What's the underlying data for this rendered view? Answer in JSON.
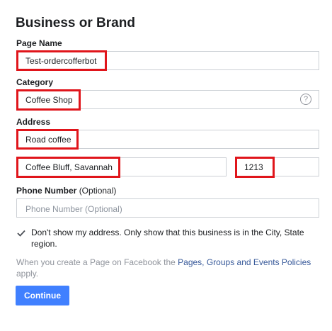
{
  "form": {
    "title": "Business or Brand",
    "page_name": {
      "label": "Page Name",
      "value": "Test-ordercofferbot"
    },
    "category": {
      "label": "Category",
      "value": "Coffee Shop",
      "help": "?"
    },
    "address": {
      "label": "Address",
      "street": "Road coffee",
      "city": "Coffee Bluff, Savannah",
      "zip": "1213"
    },
    "phone": {
      "label": "Phone Number",
      "optional": "(Optional)",
      "placeholder": "Phone Number (Optional)"
    },
    "hide_address": {
      "checked": true,
      "text": "Don't show my address. Only show that this business is in the City, State region."
    },
    "policy_note": {
      "before": "When you create a Page on Facebook the ",
      "link": "Pages, Groups and Events Policies",
      "after": " apply."
    },
    "continue_label": "Continue"
  },
  "colors": {
    "highlight": "#e0151b",
    "button": "#4080ff",
    "link": "#365899"
  }
}
